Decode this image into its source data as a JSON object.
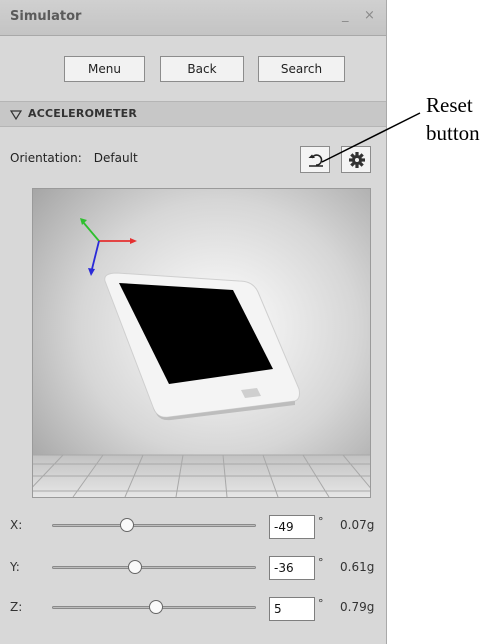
{
  "window": {
    "title": "Simulator",
    "minimize_glyph": "_",
    "close_glyph": "×"
  },
  "toolbar": {
    "menu_label": "Menu",
    "back_label": "Back",
    "search_label": "Search"
  },
  "section": {
    "title": "ACCELEROMETER",
    "expanded": true
  },
  "orientation": {
    "label": "Orientation:",
    "value": "Default"
  },
  "icons": {
    "reset": "reset-icon",
    "settings": "gear-icon"
  },
  "axes": [
    {
      "label": "X:",
      "value": "-49",
      "degree": "°",
      "g": "0.07g",
      "slider_fraction": 0.36
    },
    {
      "label": "Y:",
      "value": "-36",
      "degree": "°",
      "g": "0.61g",
      "slider_fraction": 0.4
    },
    {
      "label": "Z:",
      "value": "5",
      "degree": "°",
      "g": "0.79g",
      "slider_fraction": 0.51
    }
  ],
  "annotation": {
    "line1": "Reset",
    "line2": "button"
  },
  "colors": {
    "axis_x": "#e53030",
    "axis_y": "#2fbf2f",
    "axis_z": "#2a2ad8",
    "panel_bg": "#d8d8d8"
  }
}
